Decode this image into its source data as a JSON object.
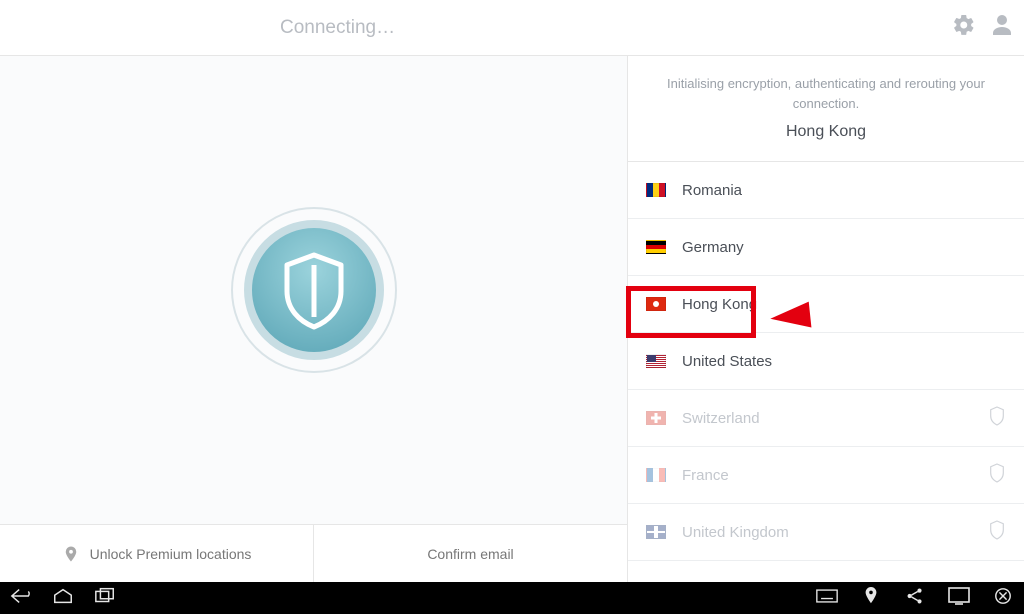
{
  "header": {
    "title": "Connecting…"
  },
  "status": {
    "message": "Initialising encryption, authenticating and rerouting your connection.",
    "selected_location": "Hong Kong"
  },
  "locations": [
    {
      "name": "Romania",
      "flag": "ro",
      "premium": false
    },
    {
      "name": "Germany",
      "flag": "de",
      "premium": false
    },
    {
      "name": "Hong Kong",
      "flag": "hk",
      "premium": false,
      "highlighted": true
    },
    {
      "name": "United States",
      "flag": "us",
      "premium": false
    },
    {
      "name": "Switzerland",
      "flag": "ch",
      "premium": true
    },
    {
      "name": "France",
      "flag": "fr",
      "premium": true
    },
    {
      "name": "United Kingdom",
      "flag": "uk",
      "premium": true
    }
  ],
  "footer": {
    "unlock_label": "Unlock Premium locations",
    "confirm_label": "Confirm email"
  },
  "annotation": {
    "type": "red-box-and-arrow",
    "target_location": "Hong Kong"
  },
  "colors": {
    "accent": "#5fb3c4",
    "annotation_red": "#e3000f",
    "muted_text": "#9aa0a8"
  }
}
